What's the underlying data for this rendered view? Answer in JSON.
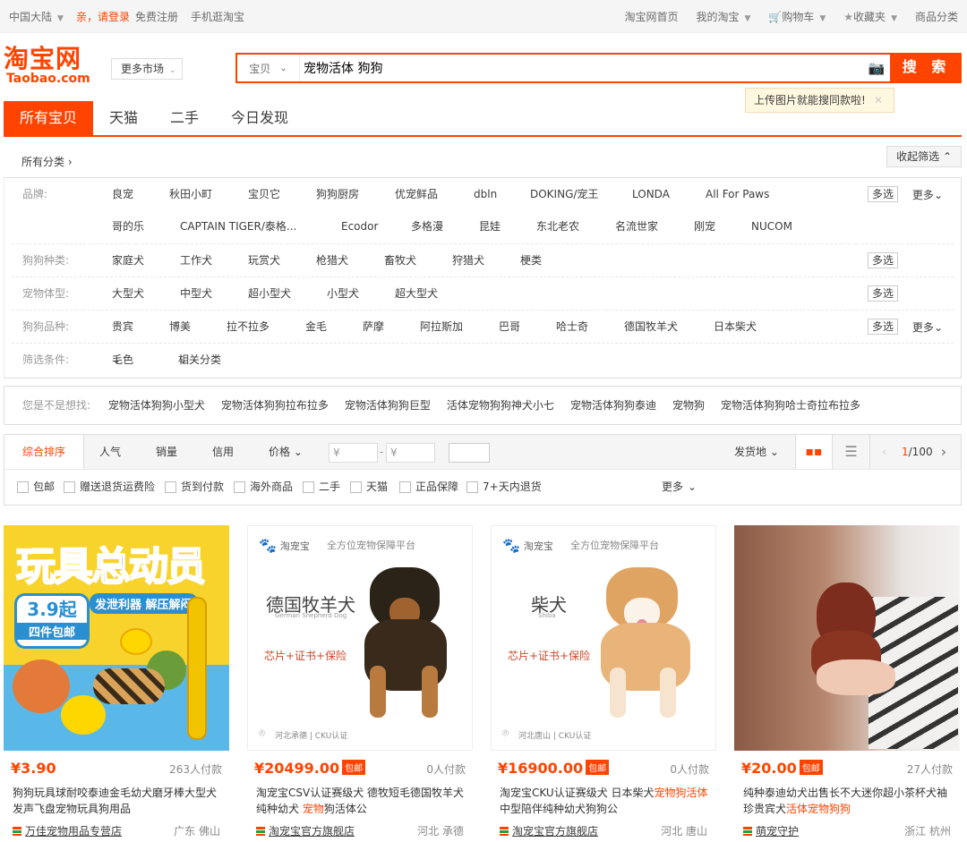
{
  "topbar": {
    "region": "中国大陆",
    "login": "亲，请登录",
    "register": "免费注册",
    "mobile": "手机逛淘宝",
    "links": [
      "淘宝网首页",
      "我的淘宝",
      "购物车",
      "收藏夹",
      "商品分类"
    ]
  },
  "header": {
    "logo_cn": "淘宝网",
    "logo_en": "Taobao.com",
    "more_market": "更多市场",
    "search_category": "宝贝",
    "search_query": "宠物活体 狗狗",
    "search_button": "搜 索",
    "upload_tip": "上传图片就能搜同款啦!"
  },
  "tabs": [
    "所有宝贝",
    "天猫",
    "二手",
    "今日发现"
  ],
  "crumbs": {
    "all": "所有分类",
    "fold": "收起筛选"
  },
  "filters": {
    "brand_label": "品牌:",
    "brands_row1": [
      "良宠",
      "秋田小町",
      "宝贝它",
      "狗狗厨房",
      "优宠鲜品",
      "dbln",
      "DOKING/宠王",
      "LONDA",
      "All For Paws"
    ],
    "brands_row2": [
      "哥的乐",
      "CAPTAIN TIGER/泰格...",
      "Ecodor",
      "多格漫",
      "昆娃",
      "东北老农",
      "名流世家",
      "刚宠",
      "NUCOM"
    ],
    "type_label": "狗狗种类:",
    "types": [
      "家庭犬",
      "工作犬",
      "玩赏犬",
      "枪猎犬",
      "畜牧犬",
      "狩猎犬",
      "梗类"
    ],
    "size_label": "宠物体型:",
    "sizes": [
      "大型犬",
      "中型犬",
      "超小型犬",
      "小型犬",
      "超大型犬"
    ],
    "breed_label": "狗狗品种:",
    "breeds": [
      "贵宾",
      "博美",
      "拉不拉多",
      "金毛",
      "萨摩",
      "阿拉斯加",
      "巴哥",
      "哈士奇",
      "德国牧羊犬",
      "日本柴犬"
    ],
    "cond_label": "筛选条件:",
    "conds": [
      "毛色",
      "相关分类"
    ],
    "multi": "多选",
    "more": "更多"
  },
  "suggest": {
    "label": "您是不是想找:",
    "items": [
      "宠物活体狗狗小型犬",
      "宠物活体狗狗拉布拉多",
      "宠物活体狗狗巨型",
      "活体宠物狗狗神犬小七",
      "宠物活体狗狗泰迪",
      "宠物狗",
      "宠物活体狗狗哈士奇拉布拉多"
    ]
  },
  "sort": {
    "items": [
      "综合排序",
      "人气",
      "销量",
      "信用",
      "价格"
    ],
    "price_min": "¥",
    "price_max": "¥",
    "ship_from": "发货地",
    "page": "1",
    "total": "/100"
  },
  "checks": [
    "包邮",
    "赠送退货运费险",
    "货到付款",
    "海外商品",
    "二手",
    "天猫",
    "正品保障",
    "7+天内退货"
  ],
  "checks_more": "更多",
  "products": [
    {
      "price": "¥3.90",
      "free": "",
      "sold": "263人付款",
      "title_pre": "狗狗玩具球耐咬泰迪金毛幼犬磨牙棒大型犬发声飞盘宠物玩具狗用品",
      "title_hl": "",
      "title_post": "",
      "shop": "万佳宠物用品专营店",
      "loc": "广东 佛山",
      "img_text1": "玩具总动员",
      "img_text2": "发泄利器 解压解闷",
      "img_text3": "3.9起",
      "img_text4": "四件包邮"
    },
    {
      "price": "¥20499.00",
      "free": "包邮",
      "sold": "0人付款",
      "title_pre": "淘宠宝CSV认证赛级犬 德牧短毛德国牧羊犬纯种幼犬 ",
      "title_hl": "宠物",
      "title_post": "狗活体公",
      "shop": "淘宠宝官方旗舰店",
      "loc": "河北 承德",
      "brand": "淘宠宝",
      "brand_sub": "全方位宠物保障平台",
      "breed_cn": "德国牧羊犬",
      "breed_en": "German Shepherd Dog",
      "slogan": "芯片+证书+保险",
      "place": "河北承德",
      "cku": "CKU认证"
    },
    {
      "price": "¥16900.00",
      "free": "包邮",
      "sold": "0人付款",
      "title_pre": "淘宠宝CKU认证赛级犬 日本柴犬",
      "title_hl": "宠物狗活体",
      "title_post": "中型陪伴纯种幼犬狗狗公",
      "shop": "淘宠宝官方旗舰店",
      "loc": "河北 唐山",
      "brand": "淘宠宝",
      "brand_sub": "全方位宠物保障平台",
      "breed_cn": "柴犬",
      "breed_en": "Shiba",
      "slogan": "芯片+证书+保险",
      "place": "河北唐山",
      "cku": "CKU认证"
    },
    {
      "price": "¥20.00",
      "free": "包邮",
      "sold": "27人付款",
      "title_pre": "纯种泰迪幼犬出售长不大迷你超小茶杯犬袖珍贵宾犬",
      "title_hl": "活体宠物狗狗",
      "title_post": "",
      "shop": "萌宠守护",
      "loc": "浙江 杭州"
    }
  ]
}
